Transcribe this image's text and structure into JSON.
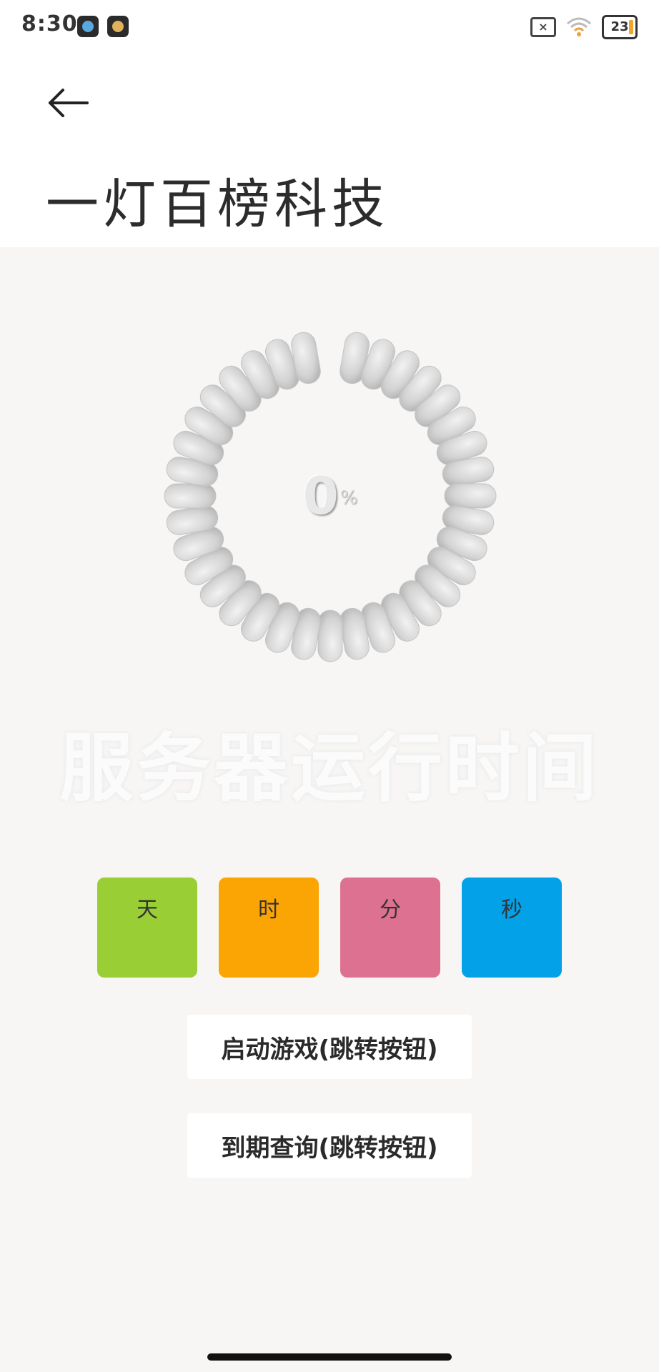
{
  "status_bar": {
    "time": "8:30",
    "battery": "23",
    "icons": [
      "globe-app-icon",
      "cloud-app-icon",
      "no-sim-icon",
      "wifi-icon",
      "battery-icon"
    ]
  },
  "header": {
    "back_icon": "arrow-left-icon",
    "title": "一灯百榜科技"
  },
  "progress": {
    "value": "0",
    "unit": "%",
    "fraction": 0
  },
  "server": {
    "heading": "服务器运行时间"
  },
  "time_units": {
    "day": "天",
    "hour": "时",
    "minute": "分",
    "second": "秒"
  },
  "actions": {
    "start_game": "启动游戏(跳转按钮)",
    "expiry_query": "到期查询(跳转按钮)"
  },
  "colors": {
    "day": "#9ace35",
    "hour": "#fba505",
    "minute": "#dd7191",
    "second": "#02a1e8",
    "ring_segment": "#d5d5d5"
  }
}
